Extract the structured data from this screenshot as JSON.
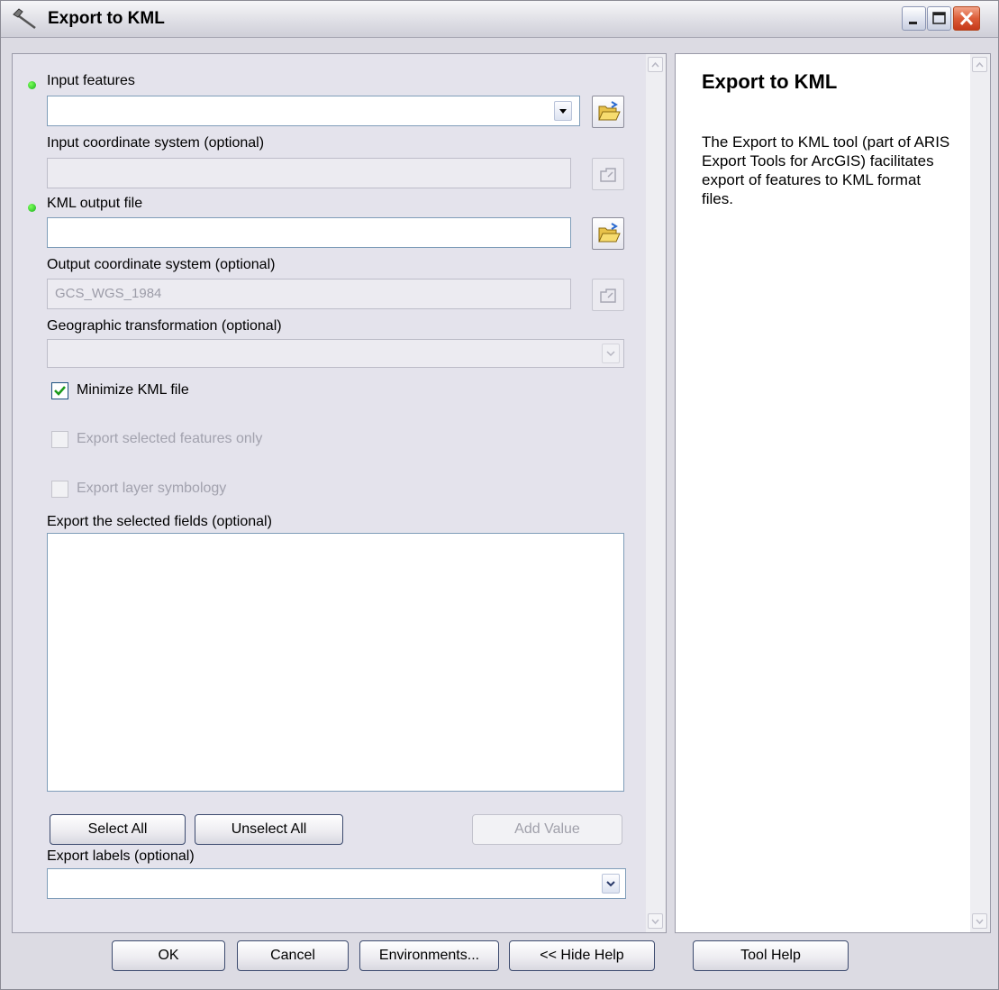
{
  "window": {
    "title": "Export to KML"
  },
  "form": {
    "input_features": {
      "label": "Input features",
      "value": ""
    },
    "input_coord": {
      "label": "Input coordinate system (optional)",
      "value": ""
    },
    "kml_output": {
      "label": "KML output file",
      "value": ""
    },
    "output_coord": {
      "label": "Output coordinate system (optional)",
      "value": "GCS_WGS_1984"
    },
    "geo_transform": {
      "label": "Geographic transformation (optional)",
      "value": ""
    },
    "minimize_kml": {
      "label": "Minimize KML file",
      "checked": true
    },
    "export_selected": {
      "label": "Export selected features only",
      "checked": false
    },
    "export_symbology": {
      "label": "Export layer symbology",
      "checked": false
    },
    "fields": {
      "label": "Export the selected fields (optional)",
      "items": []
    },
    "select_all": "Select All",
    "unselect_all": "Unselect All",
    "add_value": "Add Value",
    "export_labels": {
      "label": "Export labels (optional)",
      "value": ""
    }
  },
  "help": {
    "title": "Export to KML",
    "body": "The Export to KML tool (part of ARIS Export Tools for ArcGIS) facilitates export of features to KML format files."
  },
  "footer": {
    "ok": "OK",
    "cancel": "Cancel",
    "environments": "Environments...",
    "hide_help": "<< Hide Help",
    "tool_help": "Tool Help"
  },
  "colors": {
    "required_dot": "#19b01c",
    "close_button": "#dc5c38",
    "dialog_bg": "#dcdbe3"
  }
}
